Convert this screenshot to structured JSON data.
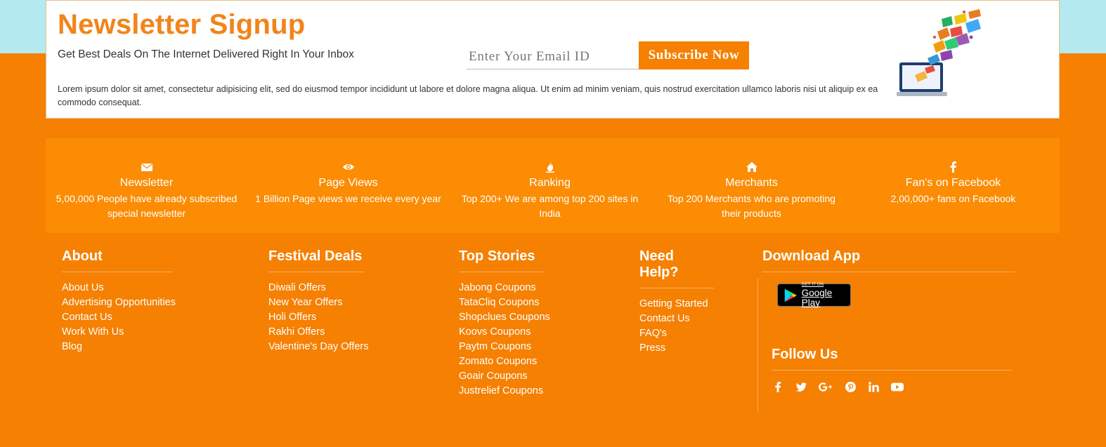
{
  "newsletter": {
    "title": "Newsletter Signup",
    "subtitle": "Get Best Deals On The Internet Delivered Right In Your Inbox",
    "email_placeholder": "Enter Your Email ID",
    "subscribe_label": "Subscribe Now",
    "body": "Lorem ipsum dolor sit amet, consectetur adipisicing elit, sed do eiusmod tempor incididunt ut labore et dolore magna aliqua. Ut enim ad minim veniam, quis nostrud exercitation ullamco laboris nisi ut aliquip ex ea commodo consequat."
  },
  "stats": [
    {
      "icon": "envelope-icon",
      "title": "Newsletter",
      "desc": "5,00,000 People have already subscribed special newsletter"
    },
    {
      "icon": "eye-icon",
      "title": "Page Views",
      "desc": "1 Billion Page views we receive every year"
    },
    {
      "icon": "fire-icon",
      "title": "Ranking",
      "desc": "Top 200+ We are among top 200 sites in India"
    },
    {
      "icon": "home-icon",
      "title": "Merchants",
      "desc": "Top 200 Merchants who are promoting their products"
    },
    {
      "icon": "facebook-icon",
      "title": "Fan's on Facebook",
      "desc": "2,00,000+ fans on Facebook"
    }
  ],
  "footer": {
    "about": {
      "title": "About",
      "links": [
        "About Us",
        "Advertising Opportunities",
        "Contact Us",
        "Work With Us",
        "Blog"
      ]
    },
    "festival": {
      "title": "Festival Deals",
      "links": [
        "Diwali Offers",
        "New Year Offers",
        "Holi Offers",
        "Rakhi Offers",
        "Valentine's Day Offers"
      ]
    },
    "stories": {
      "title": "Top Stories",
      "links": [
        "Jabong Coupons",
        "TataCliq Coupons",
        "Shopclues Coupons",
        "Koovs Coupons",
        "Paytm Coupons",
        "Zomato Coupons",
        "Goair Coupons",
        "Justrelief Coupons"
      ]
    },
    "help": {
      "title": "Need Help?",
      "links": [
        "Getting Started",
        "Contact Us",
        "FAQ's",
        "Press"
      ]
    },
    "app": {
      "title": "Download App",
      "badge_small": "GET IT ON",
      "badge_big": "Google Play"
    },
    "follow": {
      "title": "Follow Us",
      "icons": [
        "facebook-icon",
        "twitter-icon",
        "google-plus-icon",
        "pinterest-icon",
        "linkedin-icon",
        "youtube-icon"
      ]
    }
  },
  "colors": {
    "accent": "#f58002",
    "band": "#fb8c03",
    "top_bg": "#b3e9ef",
    "title": "#f2841b"
  }
}
